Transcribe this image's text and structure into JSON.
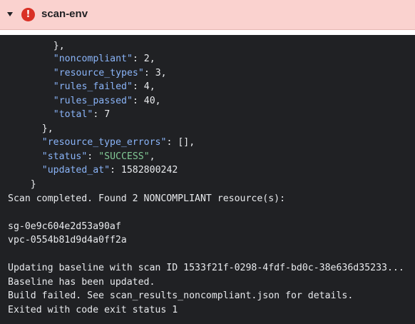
{
  "header": {
    "title": "scan-env",
    "status_icon": "error-icon",
    "expand_icon": "caret-down-icon",
    "background": "#fad2cf",
    "error_color": "#d93025"
  },
  "log": {
    "key_color": "#8ab4f8",
    "string_color": "#81c995",
    "partial_top": "},",
    "json": {
      "noncompliant_key": "\"noncompliant\"",
      "noncompliant_val": ": 2,",
      "resource_types_key": "\"resource_types\"",
      "resource_types_val": ": 3,",
      "rules_failed_key": "\"rules_failed\"",
      "rules_failed_val": ": 4,",
      "rules_passed_key": "\"rules_passed\"",
      "rules_passed_val": ": 40,",
      "total_key": "\"total\"",
      "total_val": ": 7",
      "close_inner": "},",
      "resource_type_errors_key": "\"resource_type_errors\"",
      "resource_type_errors_val": ": [],",
      "status_key": "\"status\"",
      "status_sep": ": ",
      "status_val": "\"SUCCESS\"",
      "status_end": ",",
      "updated_at_key": "\"updated_at\"",
      "updated_at_val": ": 1582800242",
      "close_outer": "}"
    },
    "scan_completed": "Scan completed. Found 2 NONCOMPLIANT resource(s):",
    "resource_1": "sg-0e9c604e2d53a90af",
    "resource_2": "vpc-0554b81d9d4a0ff2a",
    "updating_baseline": "Updating baseline with scan ID 1533f21f-0298-4fdf-bd0c-38e636d35233...",
    "baseline_updated": "Baseline has been updated.",
    "build_failed": "Build failed. See scan_results_noncompliant.json for details.",
    "exit_status": "Exited with code exit status 1"
  }
}
